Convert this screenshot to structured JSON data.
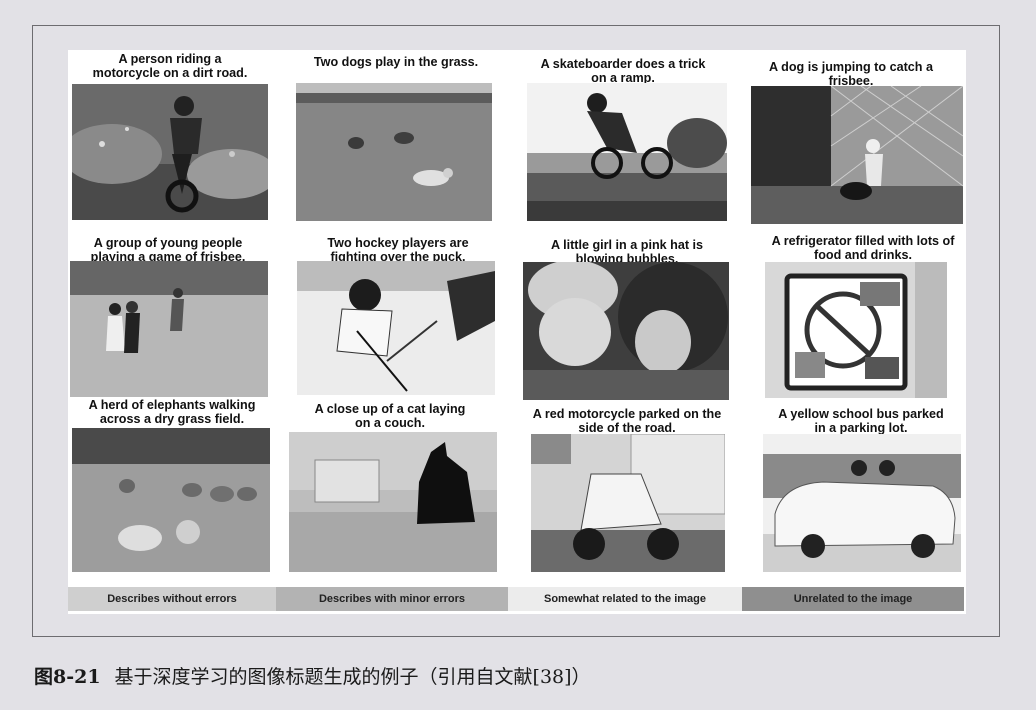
{
  "figure": {
    "number": "图8-21",
    "caption": "基于深度学习的图像标题生成的例子（引用自文献[38]）"
  },
  "panels": [
    {
      "caption_lines": [
        "A person riding a",
        "motorcycle on a dirt road."
      ]
    },
    {
      "caption_lines": [
        "Two dogs play in the grass."
      ]
    },
    {
      "caption_lines": [
        "A skateboarder does a trick",
        "on a ramp."
      ]
    },
    {
      "caption_lines": [
        "A dog is jumping to catch a",
        "frisbee."
      ]
    },
    {
      "caption_lines": [
        "A group of young people",
        "playing a game of frisbee."
      ]
    },
    {
      "caption_lines": [
        "Two hockey players are",
        "fighting over the puck."
      ]
    },
    {
      "caption_lines": [
        "A little girl in a pink hat is",
        "blowing bubbles."
      ]
    },
    {
      "caption_lines": [
        "A refrigerator filled with lots of",
        "food and drinks."
      ]
    },
    {
      "caption_lines": [
        "A herd of elephants walking",
        "across a dry grass field."
      ]
    },
    {
      "caption_lines": [
        "A close up of a cat laying",
        "on a couch."
      ]
    },
    {
      "caption_lines": [
        "A red motorcycle parked on the",
        "side of the road."
      ]
    },
    {
      "caption_lines": [
        "A yellow school bus parked",
        "in a parking lot."
      ]
    }
  ],
  "legend": [
    {
      "label": "Describes without errors",
      "color": "#cfcfcf"
    },
    {
      "label": "Describes with minor errors",
      "color": "#b3b3b3"
    },
    {
      "label": "Somewhat related to the image",
      "color": "#ececec"
    },
    {
      "label": "Unrelated to the image",
      "color": "#8f8f8f"
    }
  ]
}
